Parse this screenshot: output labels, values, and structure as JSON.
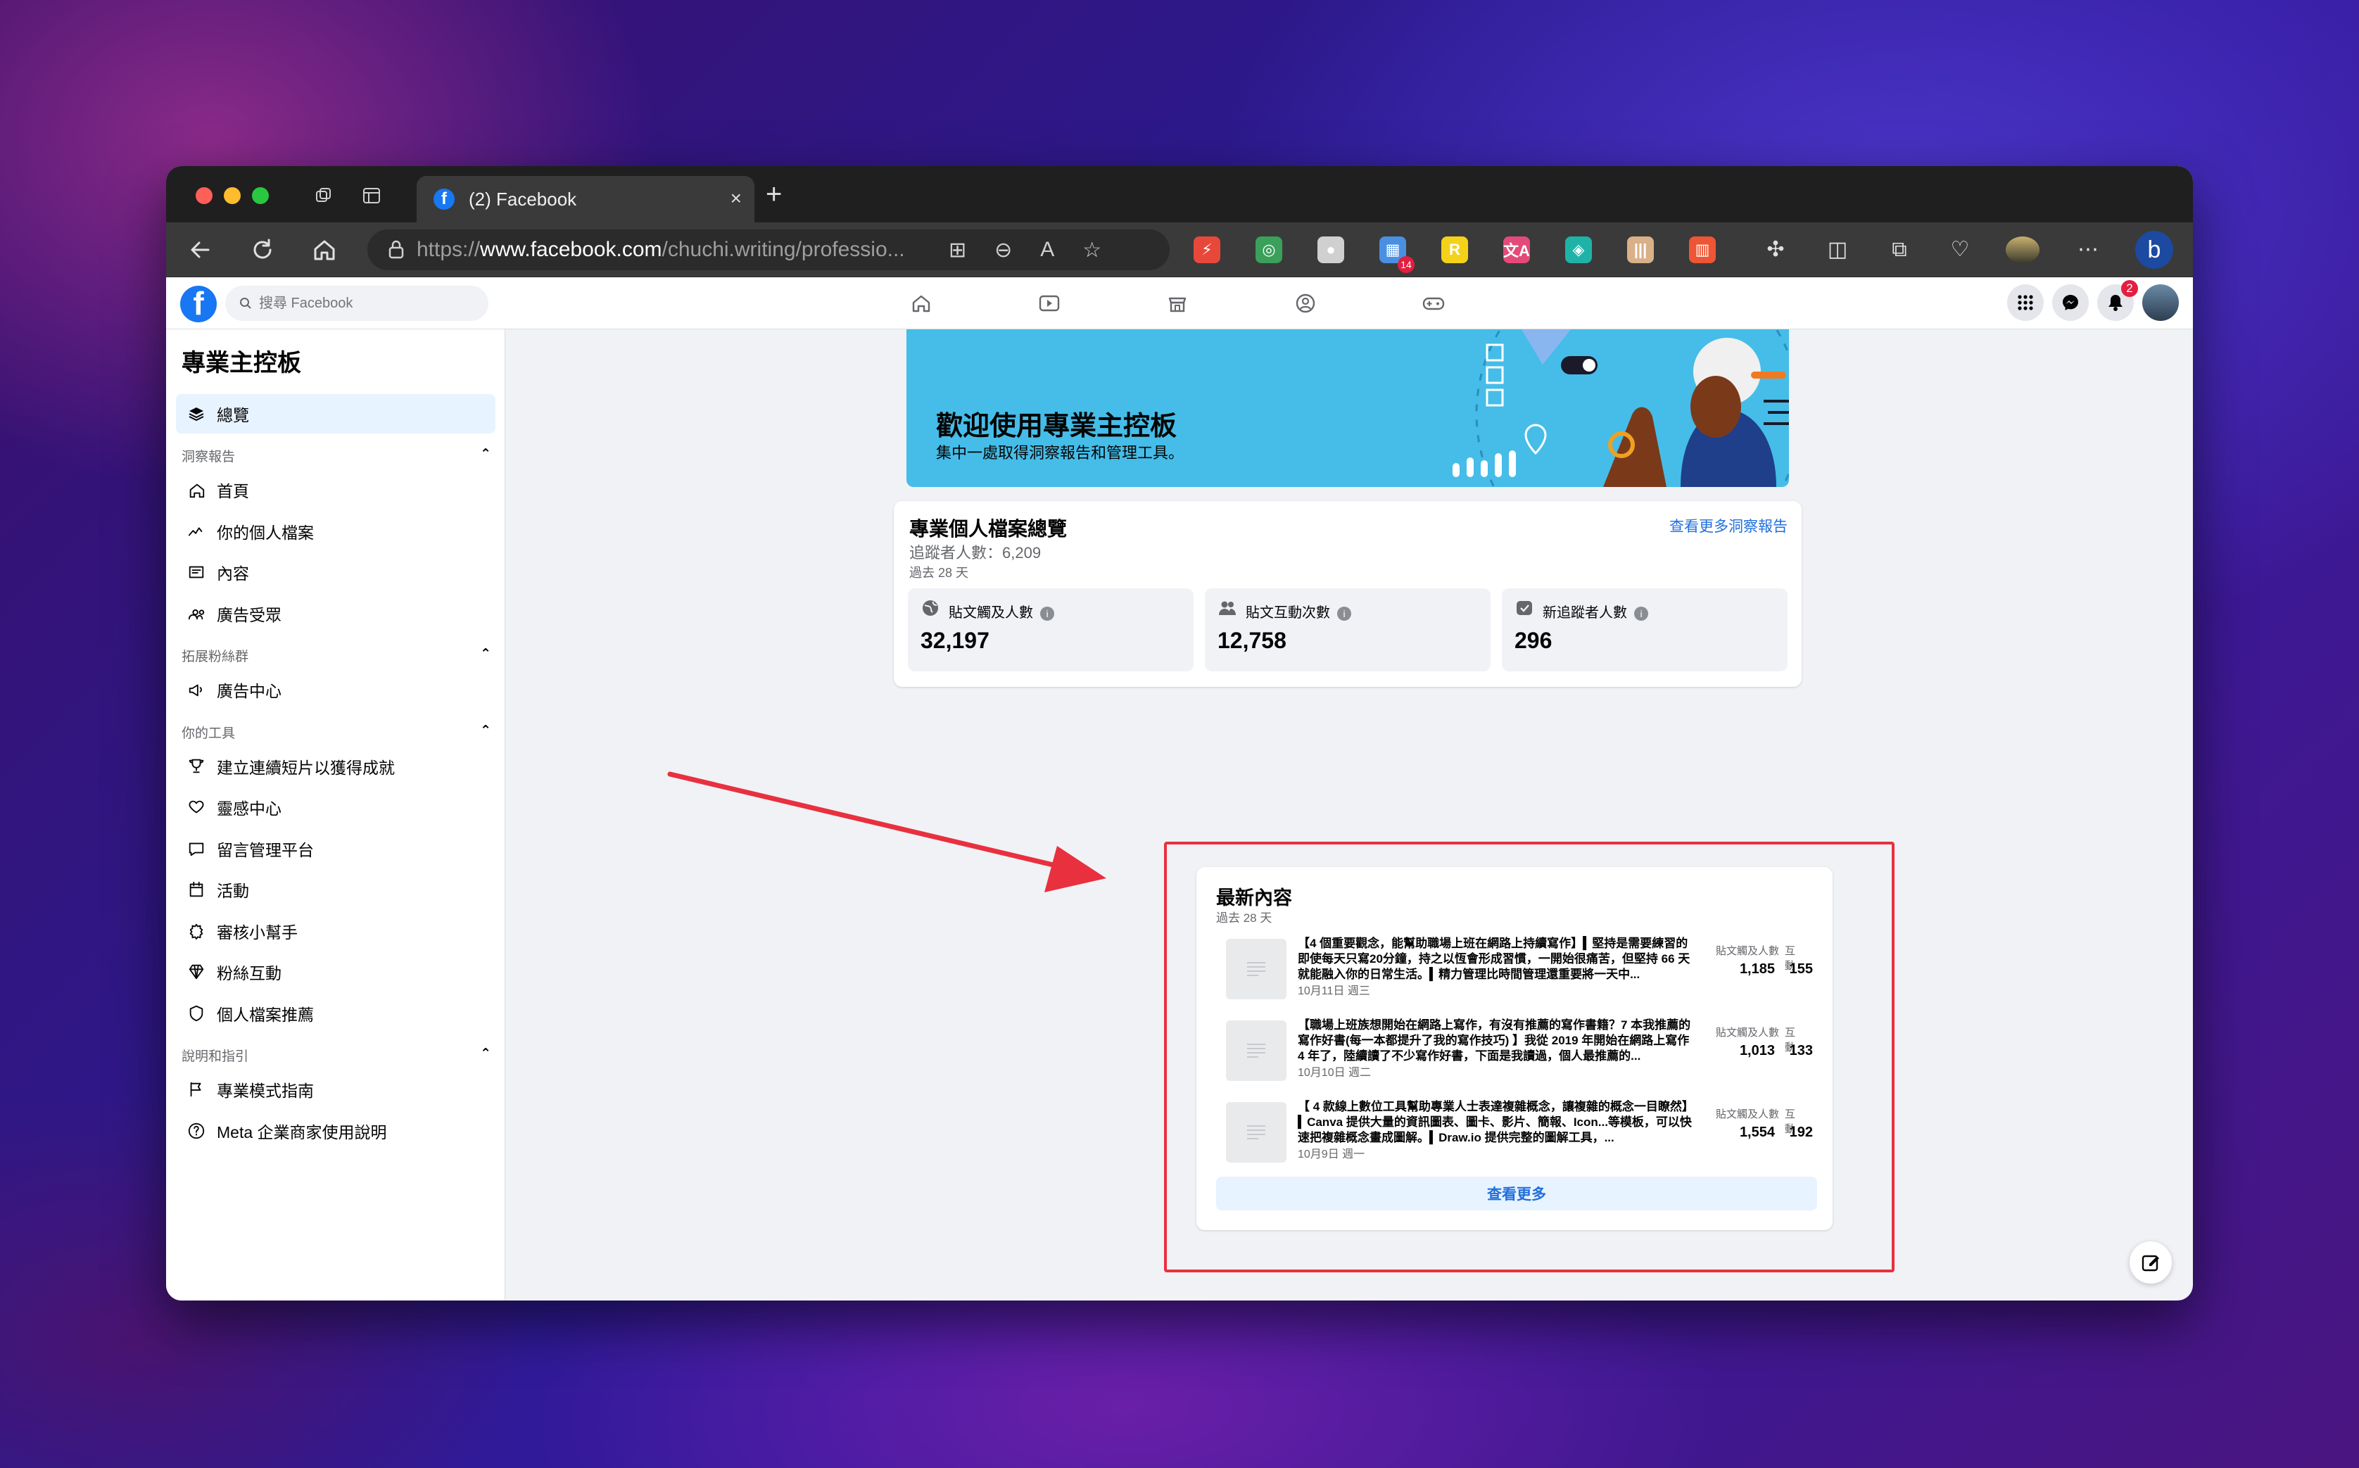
{
  "browser": {
    "tab_title": "(2) Facebook",
    "tab_favicon": "f",
    "new_tab": "+",
    "close_tab": "×",
    "url_prefix": "https://",
    "url_host": "www.facebook.com",
    "url_path": "/chuchi.writing/professio...",
    "extensions": [
      {
        "name": "speedometer-icon",
        "glyph": "⚡",
        "color": "#e8483a"
      },
      {
        "name": "puzzle-multi-icon",
        "glyph": "◎",
        "color": "#3aa05a"
      },
      {
        "name": "blob-icon",
        "glyph": "●",
        "color": "#d0d0d0"
      },
      {
        "name": "grid-badge-icon",
        "glyph": "▦",
        "color": "#4a90e2",
        "badge": "14"
      },
      {
        "name": "r-icon",
        "glyph": "R",
        "color": "#f5d21a"
      },
      {
        "name": "translate-icon",
        "glyph": "文A",
        "color": "#e34a7a"
      },
      {
        "name": "pattern-icon",
        "glyph": "◈",
        "color": "#1fb3a8"
      },
      {
        "name": "bars-icon",
        "glyph": "|||",
        "color": "#d9b088"
      },
      {
        "name": "chart-red-icon",
        "glyph": "▥",
        "color": "#ee5534"
      }
    ]
  },
  "fb": {
    "search_placeholder": "搜尋 Facebook",
    "notifications_badge": "2"
  },
  "sidebar": {
    "title": "專業主控板",
    "overview": "總覽",
    "sections": [
      {
        "label": "洞察報告",
        "items": [
          "首頁",
          "你的個人檔案",
          "內容",
          "廣告受眾"
        ]
      },
      {
        "label": "拓展粉絲群",
        "items": [
          "廣告中心"
        ]
      },
      {
        "label": "你的工具",
        "items": [
          "建立連續短片以獲得成就",
          "靈感中心",
          "留言管理平台",
          "活動",
          "審核小幫手",
          "粉絲互動",
          "個人檔案推薦"
        ]
      },
      {
        "label": "說明和指引",
        "items": [
          "專業模式指南",
          "Meta 企業商家使用說明"
        ]
      }
    ]
  },
  "banner": {
    "title": "歡迎使用專業主控板",
    "subtitle": "集中一處取得洞察報告和管理工具。"
  },
  "overview": {
    "title": "專業個人檔案總覽",
    "followers": "追蹤者人數：6,209",
    "period": "過去 28 天",
    "link": "查看更多洞察報告",
    "stats": [
      {
        "label": "貼文觸及人數",
        "value": "32,197"
      },
      {
        "label": "貼文互動次數",
        "value": "12,758"
      },
      {
        "label": "新追蹤者人數",
        "value": "296"
      }
    ]
  },
  "recent": {
    "title": "最新內容",
    "period": "過去 28 天",
    "col_reach": "貼文觸及人數",
    "col_engage": "互動",
    "posts": [
      {
        "text": "【4 個重要觀念，能幫助職場上班在網路上持續寫作】▍堅持是需要練習的即使每天只寫20分鐘，持之以恆會形成習慣，一開始很痛苦，但堅持 66 天就能融入你的日常生活。▍精力管理比時間管理還重要將一天中...",
        "date": "10月11日 週三",
        "reach": "1,185",
        "engage": "155"
      },
      {
        "text": "【職場上班族想開始在網路上寫作，有沒有推薦的寫作書籍？7 本我推薦的寫作好書(每一本都提升了我的寫作技巧) 】我從 2019 年開始在網路上寫作 4 年了，陸續讀了不少寫作好書，下面是我讀過，個人最推薦的...",
        "date": "10月10日 週二",
        "reach": "1,013",
        "engage": "133"
      },
      {
        "text": "【 4 款線上數位工具幫助專業人士表達複雜概念，讓複雜的概念一目瞭然】▍Canva 提供大量的資訊圖表、圖卡、影片、簡報、Icon...等模板，可以快速把複雜概念畫成圖解。▍Draw.io 提供完整的圖解工具，...",
        "date": "10月9日 週一",
        "reach": "1,554",
        "engage": "192"
      }
    ],
    "see_more": "查看更多"
  },
  "colors": {
    "fb_blue": "#1877f2",
    "link": "#216fdb",
    "highlight": "#e8303f",
    "arrow": "#e8303f"
  }
}
